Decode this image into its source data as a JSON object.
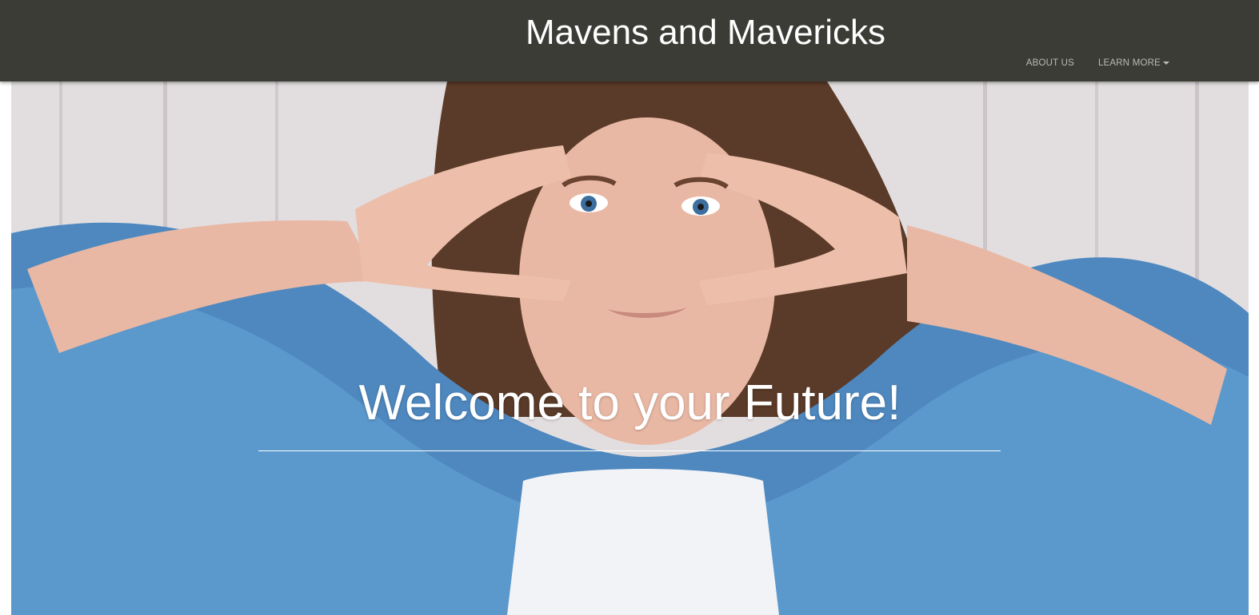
{
  "header": {
    "site_title": "Mavens and Mavericks",
    "logo_alt": "MM"
  },
  "nav": {
    "items": [
      {
        "label": "ABOUT US",
        "has_dropdown": false
      },
      {
        "label": "LEARN MORE",
        "has_dropdown": true
      }
    ]
  },
  "account": {
    "icon": "account-circle-icon"
  },
  "hero": {
    "heading": "Welcome to your Future!"
  },
  "colors": {
    "navbar": "#3c3c37",
    "accent": "#2196f3",
    "nav_text": "#b9b9b9"
  }
}
